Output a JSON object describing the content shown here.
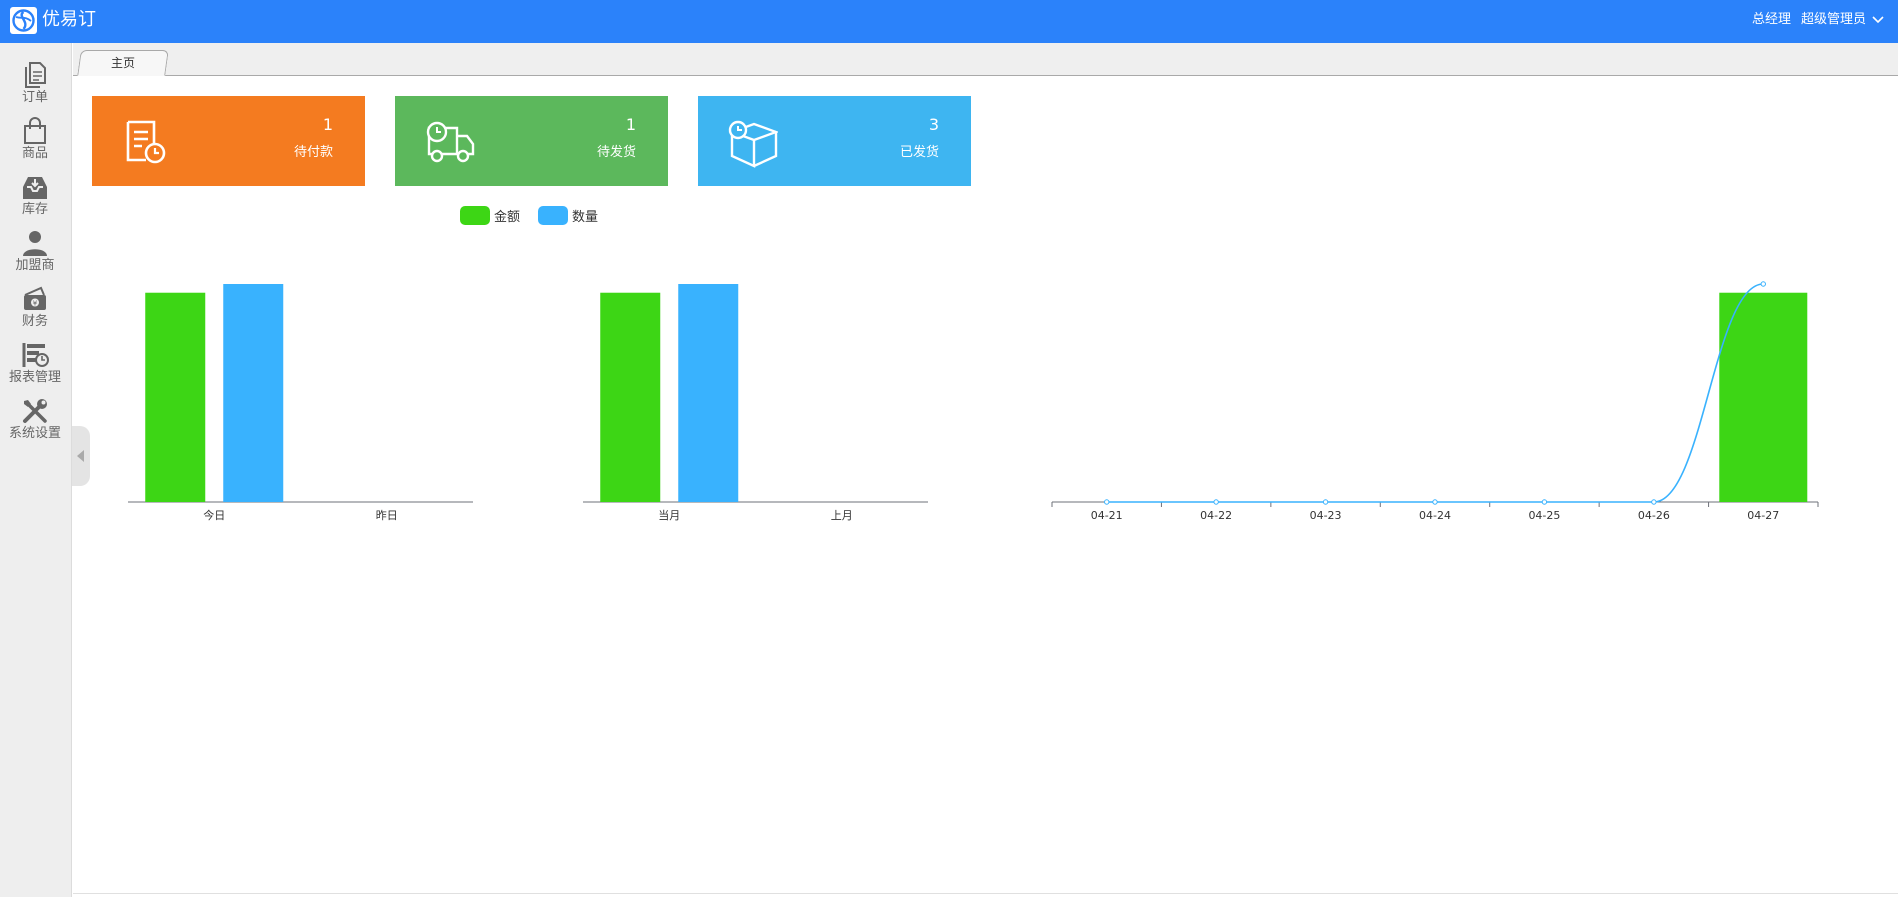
{
  "app": {
    "title": "优易订"
  },
  "header": {
    "role": "总经理",
    "user": "超级管理员"
  },
  "sidebar": {
    "items": [
      {
        "label": "订单",
        "icon": "document-icon"
      },
      {
        "label": "商品",
        "icon": "shopping-bag-icon"
      },
      {
        "label": "库存",
        "icon": "inbox-icon"
      },
      {
        "label": "加盟商",
        "icon": "user-icon"
      },
      {
        "label": "财务",
        "icon": "money-icon"
      },
      {
        "label": "报表管理",
        "icon": "report-icon"
      },
      {
        "label": "系统设置",
        "icon": "tools-icon"
      }
    ]
  },
  "tabs": [
    {
      "label": "主页"
    }
  ],
  "cards": [
    {
      "count": "1",
      "label": "待付款",
      "color": "#f47b20",
      "icon": "invoice-clock-icon"
    },
    {
      "count": "1",
      "label": "待发货",
      "color": "#5cb85c",
      "icon": "delivery-truck-icon"
    },
    {
      "count": "3",
      "label": "已发货",
      "color": "#3eb5f1",
      "icon": "package-clock-icon"
    }
  ],
  "legend": [
    {
      "name": "金额",
      "color": "#3dd615"
    },
    {
      "name": "数量",
      "color": "#39b2fe"
    }
  ],
  "chart_data": [
    {
      "type": "bar",
      "categories": [
        "今日",
        "昨日"
      ],
      "series": [
        {
          "name": "金额",
          "values": [
            4.8,
            0
          ]
        },
        {
          "name": "数量",
          "values": [
            5,
            0
          ]
        }
      ],
      "ylim": [
        0,
        5
      ],
      "grid": false
    },
    {
      "type": "bar",
      "categories": [
        "当月",
        "上月"
      ],
      "series": [
        {
          "name": "金额",
          "values": [
            4.8,
            0
          ]
        },
        {
          "name": "数量",
          "values": [
            5,
            0
          ]
        }
      ],
      "ylim": [
        0,
        5
      ],
      "grid": false
    },
    {
      "type": "bar+line",
      "categories": [
        "04-21",
        "04-22",
        "04-23",
        "04-24",
        "04-25",
        "04-26",
        "04-27"
      ],
      "series": [
        {
          "name": "金额",
          "type": "bar",
          "values": [
            0,
            0,
            0,
            0,
            0,
            0,
            4.8
          ]
        },
        {
          "name": "数量",
          "type": "line",
          "values": [
            0,
            0,
            0,
            0,
            0,
            0,
            5
          ]
        }
      ],
      "ylim": [
        0,
        5
      ],
      "grid": false
    }
  ]
}
